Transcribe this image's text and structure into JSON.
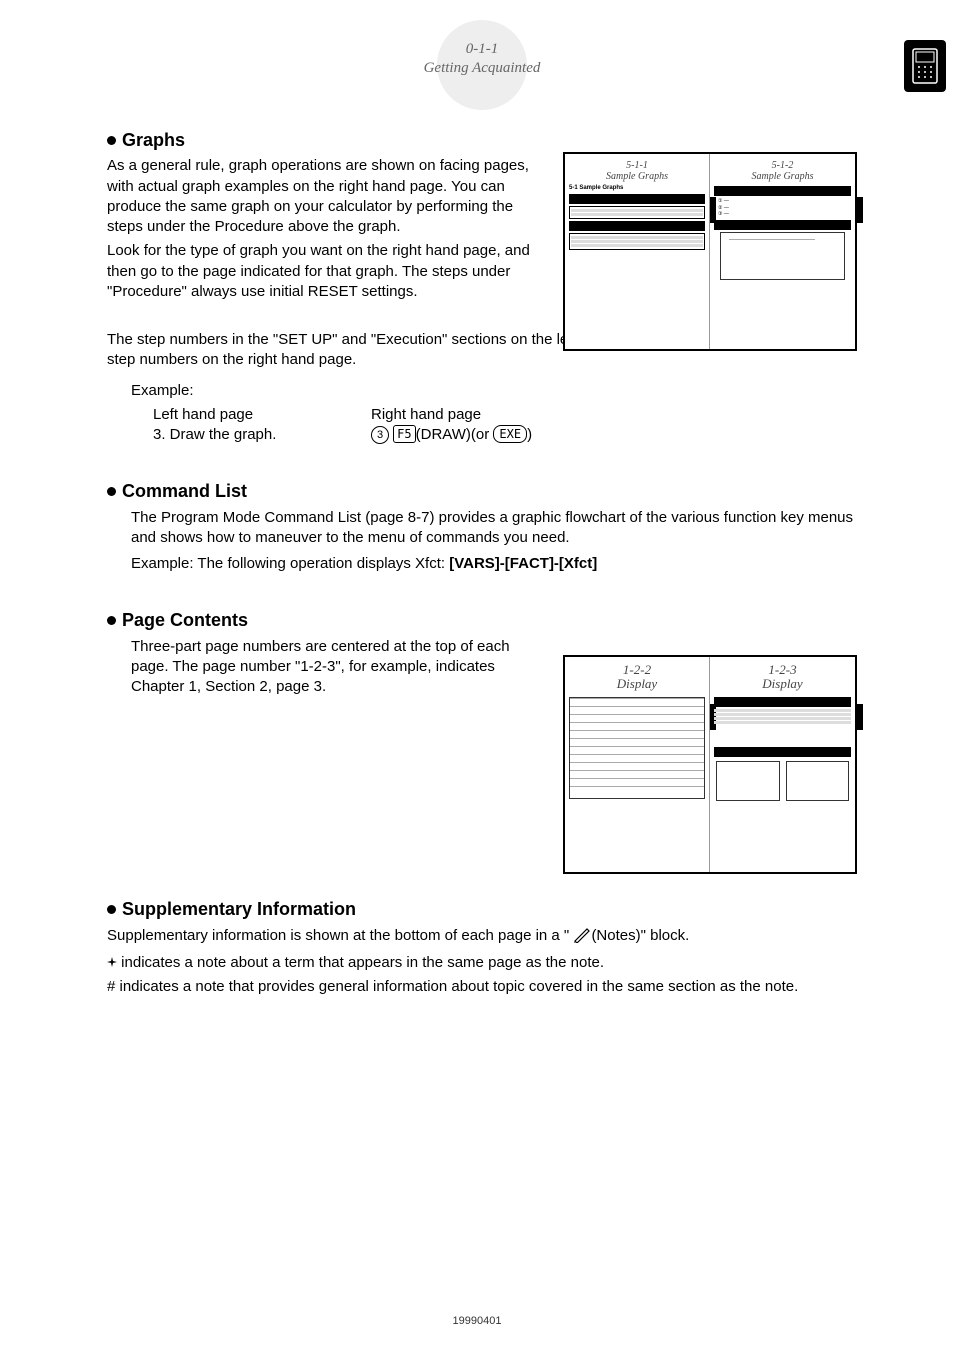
{
  "badge": {
    "pagenum": "0-1-1",
    "title": "Getting Acquainted"
  },
  "sec_graphs": {
    "heading": "Graphs",
    "p1a": "As a general rule, graph operations are shown on facing pages, with actual graph examples on the right hand page. You can produce the same graph on your calculator by performing the steps under the Procedure above the graph.",
    "p1b": "Look for the type of graph you want on the right hand page, and then go to the page indicated for that graph. The steps under \"Procedure\" always use initial RESET settings.",
    "p2": "The step numbers in the \"SET UP\" and \"Execution\" sections on the left hand page correspond to the \"Procedure\" step numbers on the right hand page.",
    "example_label": "Example:",
    "col_left_head": "Left hand page",
    "col_right_head": "Right hand page",
    "col_left_body": "3. Draw the graph.",
    "step_num": "3",
    "key_f5": "F5",
    "key_text": "(DRAW)(or ",
    "key_exe": "EXE",
    "key_close": ")"
  },
  "sec_cmd": {
    "heading": "Command List",
    "p1": "The Program Mode Command List (page 8-7) provides a graphic flowchart of the various function key menus and shows how to maneuver to the menu of commands you need.",
    "example_prefix": "Example: The following operation displays Xfct: ",
    "example_keys": "[VARS]-[FACT]-[Xfct]"
  },
  "sec_page": {
    "heading": "Page Contents",
    "p1": "Three-part page numbers are centered at the top of each page. The page number \"1-2-3\", for example, indicates Chapter 1, Section 2, page 3."
  },
  "sec_supp": {
    "heading": "Supplementary Information",
    "p1a": "Supplementary information is shown at the bottom of each page in a \" ",
    "p1b": "(Notes)\" block.",
    "bullet_star": "indicates a note about a term that appears in the same page as the note.",
    "bullet_hash": "# indicates a note that provides general information about topic covered in the same section as the note."
  },
  "thumb1": {
    "left_num": "5-1-1",
    "left_title": "Sample Graphs",
    "left_h": "5-1 Sample Graphs",
    "right_num": "5-1-2",
    "right_title": "Sample Graphs"
  },
  "thumb2": {
    "left_num": "1-2-2",
    "left_title": "Display",
    "right_num": "1-2-3",
    "right_title": "Display"
  },
  "footer": "19990401"
}
